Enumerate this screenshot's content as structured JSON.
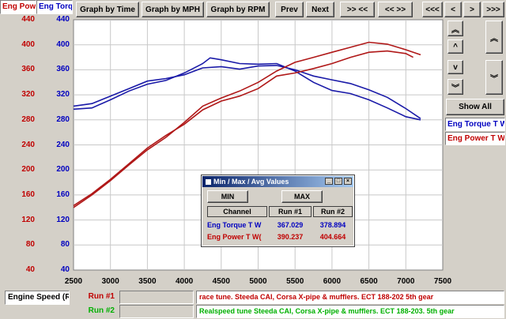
{
  "channels": {
    "power_short": "Eng Pow",
    "torque_short": "Eng Torq"
  },
  "toolbar": {
    "graph_time": "Graph by Time",
    "graph_mph": "Graph by MPH",
    "graph_rpm": "Graph by RPM",
    "prev": "Prev",
    "next": "Next",
    "zoom_in": ">> <<",
    "zoom_out": "<< >>",
    "scroll_left_fast": "<<<",
    "scroll_left": "<",
    "scroll_right": ">",
    "scroll_right_fast": ">>>"
  },
  "side": {
    "up_fast": "︽",
    "up": "^",
    "down": "v",
    "down_fast": "︾",
    "up_fast_right": "︽",
    "down_fast_right": "︾",
    "show_all": "Show All",
    "legend_torque": "Eng Torque T W",
    "legend_power": "Eng Power T W"
  },
  "axis": {
    "x_channel": "Engine Speed (R",
    "red_ticks": [
      "440",
      "400",
      "360",
      "320",
      "280",
      "240",
      "200",
      "160",
      "120",
      "80",
      "40"
    ],
    "blue_ticks": [
      "440",
      "400",
      "360",
      "320",
      "280",
      "240",
      "200",
      "160",
      "120",
      "80",
      "40"
    ],
    "x_ticks": [
      "2500",
      "3000",
      "3500",
      "4000",
      "4500",
      "5000",
      "5500",
      "6000",
      "6500",
      "7000",
      "7500"
    ]
  },
  "colors": {
    "torque": "#1a1aa8",
    "power": "#b01818",
    "red_axis": "#c00000",
    "blue_axis": "#0000c0",
    "run1_text": "#c00000",
    "run2_text": "#00b000"
  },
  "dialog": {
    "title": "Min / Max / Avg Values",
    "min_btn": "MIN",
    "max_btn": "MAX",
    "col_channel": "Channel",
    "col_run1": "Run #1",
    "col_run2": "Run #2",
    "rows": [
      {
        "channel": "Eng Torque T W",
        "run1": "367.029",
        "run2": "378.894"
      },
      {
        "channel": "Eng Power T W(",
        "run1": "390.237",
        "run2": "404.664"
      }
    ]
  },
  "runs": [
    {
      "label": "Run #1",
      "description": "race tune. Steeda CAI, Corsa X-pipe & mufflers. ECT 188-202  5th gear"
    },
    {
      "label": "Run #2",
      "description": "Realspeed tune Steeda CAI, Corsa X-pipe & mufflers. ECT 188-203. 5th gear"
    }
  ],
  "chart_data": {
    "type": "line",
    "xlabel": "Engine Speed (R",
    "xlim": [
      2500,
      7500
    ],
    "ylim": [
      40,
      440
    ],
    "grid": true,
    "series": [
      {
        "name": "Eng Torque T W",
        "run": "Run #1",
        "color": "#1a1aa8",
        "x": [
          2500,
          2750,
          3000,
          3250,
          3500,
          3750,
          4000,
          4250,
          4500,
          4750,
          5000,
          5250,
          5500,
          5750,
          6000,
          6250,
          6500,
          6750,
          7000,
          7200
        ],
        "y": [
          302,
          306,
          318,
          330,
          342,
          346,
          352,
          363,
          365,
          361,
          366,
          367,
          360,
          350,
          344,
          338,
          328,
          316,
          298,
          282
        ]
      },
      {
        "name": "Eng Torque T W",
        "run": "Run #2",
        "color": "#1a1aa8",
        "x": [
          2500,
          2750,
          3000,
          3250,
          3500,
          3750,
          4000,
          4250,
          4350,
          4500,
          4750,
          5000,
          5250,
          5500,
          5750,
          6000,
          6250,
          6500,
          6750,
          7000,
          7200
        ],
        "y": [
          297,
          299,
          312,
          326,
          337,
          343,
          355,
          370,
          379,
          376,
          370,
          369,
          370,
          358,
          340,
          327,
          322,
          312,
          299,
          285,
          280
        ]
      },
      {
        "name": "Eng Power T W",
        "run": "Run #1",
        "color": "#b01818",
        "x": [
          2500,
          2750,
          3000,
          3250,
          3500,
          3750,
          4000,
          4250,
          4500,
          4750,
          5000,
          5250,
          5500,
          5750,
          6000,
          6250,
          6500,
          6750,
          7000,
          7100
        ],
        "y": [
          143,
          162,
          185,
          210,
          235,
          255,
          273,
          296,
          310,
          318,
          330,
          350,
          355,
          362,
          370,
          380,
          388,
          390,
          386,
          380
        ]
      },
      {
        "name": "Eng Power T W",
        "run": "Run #2",
        "color": "#b01818",
        "x": [
          2500,
          2750,
          3000,
          3250,
          3500,
          3750,
          4000,
          4250,
          4500,
          4750,
          5000,
          5250,
          5500,
          5750,
          6000,
          6250,
          6500,
          6750,
          7000,
          7200
        ],
        "y": [
          140,
          160,
          183,
          208,
          232,
          252,
          276,
          302,
          315,
          326,
          340,
          358,
          372,
          380,
          388,
          396,
          404,
          401,
          392,
          384
        ]
      }
    ]
  }
}
